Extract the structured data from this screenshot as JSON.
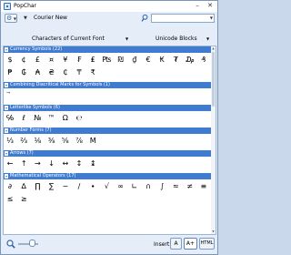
{
  "window": {
    "title": "PopChar",
    "buttons": {
      "minimize": "–",
      "close": "✕"
    }
  },
  "toolbar": {
    "menu_icon": "gear-icon",
    "font_name": "Courier New",
    "search_placeholder": ""
  },
  "filter": {
    "scope": "Characters of Current Font",
    "sort": "Unicode Blocks"
  },
  "sections": [
    {
      "label": "Currency Symbols (22)",
      "rows": [
        [
          "$",
          "¢",
          "£",
          "¤",
          "¥",
          "₣",
          "₤",
          "₧",
          "₪",
          "₫",
          "€",
          "₭",
          "₮",
          "₯",
          "₰"
        ],
        [
          "₱",
          "₲",
          "₳",
          "₴",
          "₵",
          "₸",
          "₹"
        ]
      ]
    },
    {
      "label": "Combining Diacritical Marks for Symbols (1)",
      "rows": [
        [
          "⃗"
        ]
      ]
    },
    {
      "label": "Letterlike Symbols (6)",
      "rows": [
        [
          "℅",
          "ℓ",
          "№",
          "™",
          "Ω",
          "℮"
        ]
      ]
    },
    {
      "label": "Number Forms (7)",
      "rows": [
        [
          "⅓",
          "⅔",
          "⅛",
          "⅜",
          "⅝",
          "⅞",
          "Ⅿ"
        ]
      ]
    },
    {
      "label": "Arrows (7)",
      "rows": [
        [
          "←",
          "↑",
          "→",
          "↓",
          "↔",
          "↕",
          "↨"
        ]
      ]
    },
    {
      "label": "Mathematical Operators (17)",
      "rows": [
        [
          "∂",
          "∆",
          "∏",
          "∑",
          "−",
          "∕",
          "∙",
          "√",
          "∞",
          "∟",
          "∩",
          "∫",
          "≈",
          "≠",
          "≡"
        ],
        [
          "≤",
          "≥"
        ]
      ]
    }
  ],
  "statusbar": {
    "zoom_icon": "magnifier-icon",
    "insert_label": "Insert:",
    "insert_buttons": [
      "A",
      "A+",
      "HTML"
    ]
  }
}
